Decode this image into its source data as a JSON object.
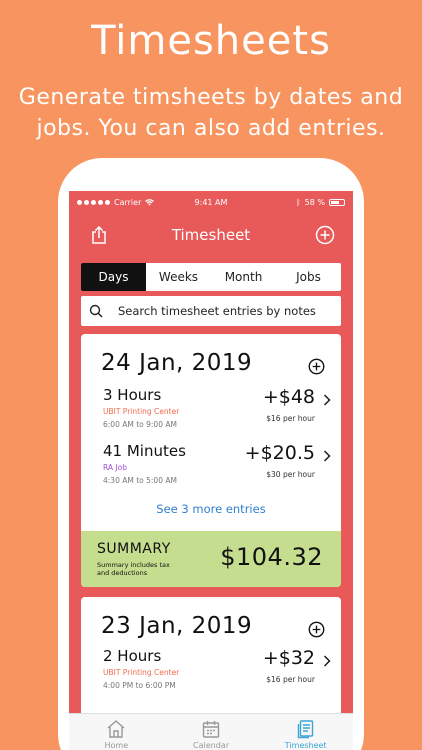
{
  "promo": {
    "title": "Timesheets",
    "subtitle": "Generate timsheets by dates and jobs. You can also add entries."
  },
  "statusbar": {
    "carrier": "Carrier",
    "time": "9:41 AM",
    "battery": "58 %"
  },
  "navbar": {
    "title": "Timesheet",
    "left_icon": "share-icon",
    "right_icon": "plus-circle-icon"
  },
  "segments": {
    "items": [
      {
        "label": "Days",
        "active": true
      },
      {
        "label": "Weeks",
        "active": false
      },
      {
        "label": "Month",
        "active": false
      },
      {
        "label": "Jobs",
        "active": false
      }
    ]
  },
  "search": {
    "placeholder": "Search timesheet entries by notes"
  },
  "cards": [
    {
      "date": "24 Jan, 2019",
      "entries": [
        {
          "duration": "3 Hours",
          "job": "UBIT Printing Center",
          "job_color": "#F26B4E",
          "range": "6:00 AM to 9:00 AM",
          "amount": "+$48",
          "rate": "$16 per hour"
        },
        {
          "duration": "41 Minutes",
          "job": "RA Job",
          "job_color": "#A24FD6",
          "range": "4:30 AM to 5:00 AM",
          "amount": "+$20.5",
          "rate": "$30 per hour"
        }
      ],
      "see_more": "See 3 more entries",
      "summary": {
        "label": "SUMMARY",
        "note": "Summary includes tax and deductions",
        "total": "$104.32"
      }
    },
    {
      "date": "23 Jan, 2019",
      "entries": [
        {
          "duration": "2 Hours",
          "job": "UBIT Printing Center",
          "job_color": "#F26B4E",
          "range": "4:00 PM to 6:00 PM",
          "amount": "+$32",
          "rate": "$16 per hour"
        }
      ]
    }
  ],
  "tabbar": {
    "items": [
      {
        "label": "Home",
        "icon": "home-icon",
        "active": false
      },
      {
        "label": "Calendar",
        "icon": "calendar-icon",
        "active": false
      },
      {
        "label": "Timesheet",
        "icon": "timesheet-icon",
        "active": true
      }
    ]
  },
  "colors": {
    "background": "#F7945F",
    "header": "#E85A5A",
    "summary": "#C5DD8E",
    "link": "#2F7FD0",
    "tab_active": "#3CA6D8"
  }
}
